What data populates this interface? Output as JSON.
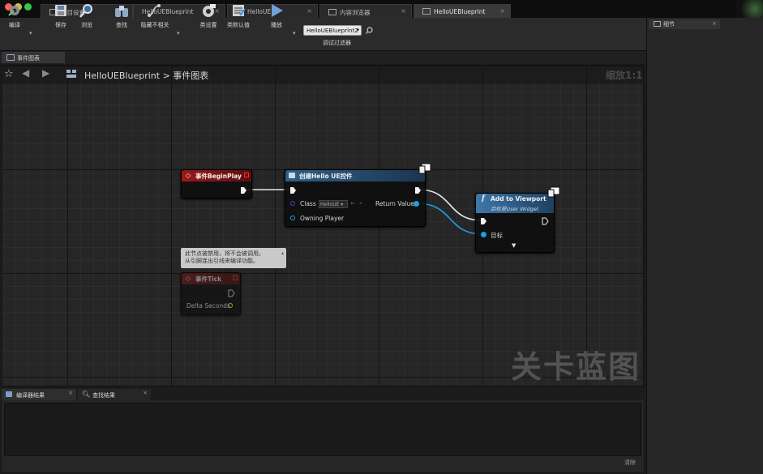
{
  "window_tabs": [
    {
      "label": "项目设置",
      "active": false
    },
    {
      "label": "HelloUEBlueprint",
      "active": false
    },
    {
      "label": "HelloUE",
      "active": false
    },
    {
      "label": "内容浏览器",
      "active": false
    },
    {
      "label": "HelloUEBlueprint",
      "active": true
    }
  ],
  "toolbar": {
    "compile_label": "编译",
    "save_label": "保存",
    "browse_label": "浏览",
    "find_label": "查找",
    "hide_unrelated_label": "隐藏不相关",
    "class_settings_label": "类设置",
    "class_defaults_label": "类默认值",
    "play_label": "播放",
    "debug_filter_value": "HelloUEBlueprint2",
    "debug_filter_label": "调试过滤器"
  },
  "details_panel": {
    "tab_label": "细节"
  },
  "graph_tab": {
    "label": "事件图表"
  },
  "breadcrumb": {
    "blueprint": "HelloUEBlueprint",
    "separator": ">",
    "graph": "事件图表",
    "zoom": "缩放1:1"
  },
  "nodes": {
    "begin_play": {
      "title": "事件BeginPlay"
    },
    "create_widget": {
      "title": "创建Hello UE控件",
      "class_label": "Class",
      "class_value": "HelloUE",
      "owning_player_label": "Owning Player",
      "return_value_label": "Return Value"
    },
    "add_to_viewport": {
      "title": "Add to Viewport",
      "subtitle": "目标是User Widget",
      "target_label": "目标"
    },
    "tick": {
      "title": "事件Tick",
      "delta_label": "Delta Seconds",
      "disabled_comment_line1": "此节点被禁用，将不会被调用。",
      "disabled_comment_line2": "从引脚连出引线来编译功能。"
    }
  },
  "graph_watermark": "关卡蓝图",
  "bottom_tabs": [
    {
      "label": "编译器结果"
    },
    {
      "label": "查找结果"
    }
  ],
  "bottom": {
    "clear_label": "清除"
  },
  "colors": {
    "event_header": "#8a1515",
    "function_header": "#2f5f86",
    "object_pin": "#1aa0e8",
    "float_pin": "#8ce342",
    "class_pin": "#5a1a9c"
  }
}
